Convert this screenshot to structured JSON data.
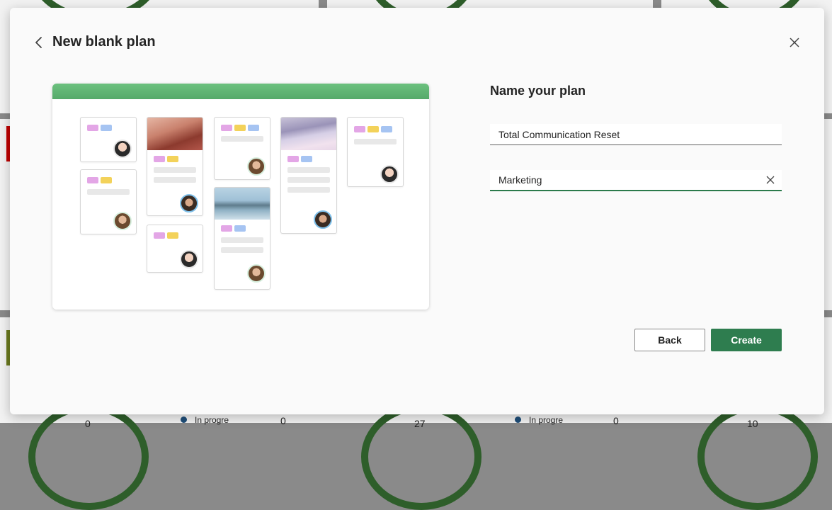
{
  "modal": {
    "title": "New blank plan",
    "back_icon": "chevron-left-icon",
    "close_icon": "close-icon"
  },
  "form": {
    "heading": "Name your plan",
    "plan_name_value": "Total Communication Reset",
    "group_value": "Marketing",
    "clear_icon": "close-icon"
  },
  "buttons": {
    "back_label": "Back",
    "create_label": "Create"
  },
  "background": {
    "status_label_1": "In progre",
    "status_label_2": "In progre",
    "count_1": "0",
    "count_2": "0",
    "big_num_1": "0",
    "big_num_2": "27",
    "big_num_3": "10"
  },
  "colors": {
    "accent": "#2e7d4f",
    "preview_header": "#5fb573",
    "dashboard_ring": "#2e5e2a"
  }
}
